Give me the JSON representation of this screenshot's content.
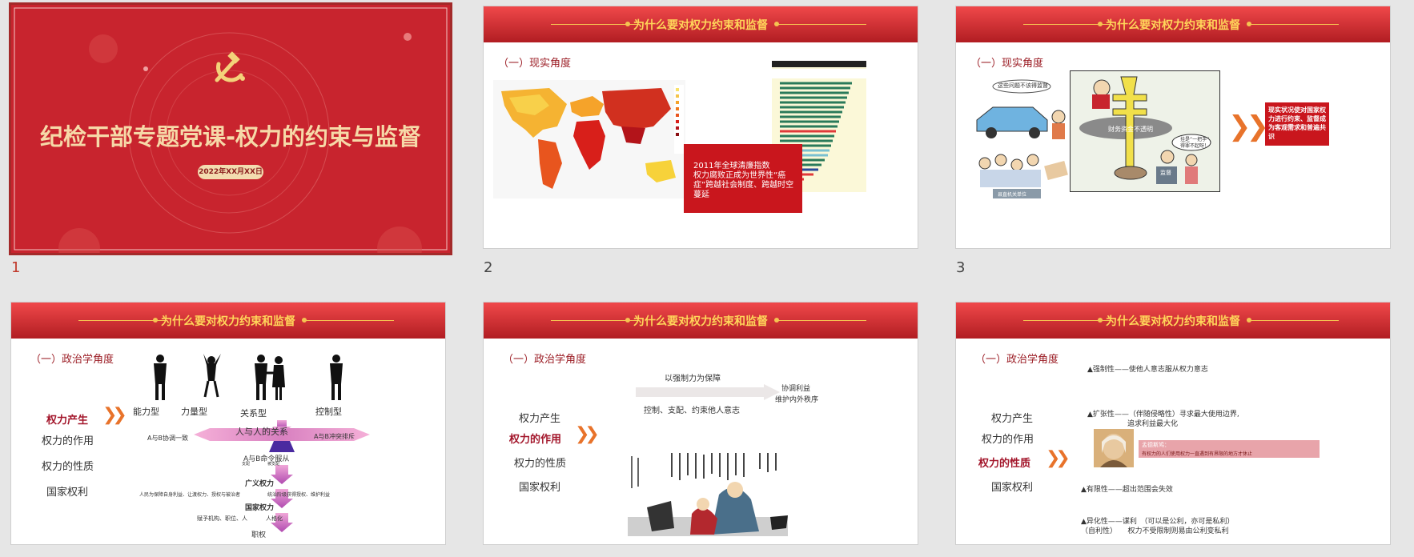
{
  "header": "为什么要对权力约束和监督",
  "slide_numbers": [
    "1",
    "2",
    "3",
    "4",
    "5",
    "6"
  ],
  "slide1": {
    "title": "纪检干部专题党课-权力的约束与监督",
    "date": "2022年XX月XX日"
  },
  "slide2": {
    "subtitle": "（一）现实角度",
    "callout": "2011年全球清廉指数\n权力腐败正成为世界性“癌症”跨越社会制度、跨越时空蔓延"
  },
  "slide3": {
    "subtitle": "（一）现实角度",
    "bubble1": "这些问题不该得监督",
    "sign1": "财务资金不透明",
    "bubble2": "挂是“一把手”\n得罪不起呀！",
    "label1": "监督",
    "sign2": "县直机关单位",
    "conclusion": "现实状况使对国家权力进行约束、监督成为客观需求和普遍共识"
  },
  "slide4": {
    "subtitle": "（一）政治学角度",
    "menu": [
      "权力产生",
      "权力的作用",
      "权力的性质",
      "国家权利"
    ],
    "types": [
      "能力型",
      "力量型",
      "关系型",
      "控制型"
    ],
    "diagram": {
      "relation": "人与人的关系",
      "left": "A与B协调一致",
      "right": "A与B冲突排斥",
      "obey": "A与B命令服从",
      "small_l": "支配",
      "small_r": "被支配",
      "broad": "广义权力",
      "broad_l": "人民为保障自身利益、让渡权力、授权与被治者",
      "broad_r": "统治阶级获得授权、维护利益",
      "narrow": "国家权力",
      "narrow_l": "赋予机构、职位、人",
      "narrow_r": "人格化",
      "duty": "职权"
    }
  },
  "slide5": {
    "subtitle": "（一）政治学角度",
    "menu": [
      "权力产生",
      "权力的作用",
      "权力的性质",
      "国家权利"
    ],
    "top": "以强制力为保障",
    "bottom": "控制、支配、约束他人意志",
    "right1": "协调利益",
    "right2": "维护内外秩序"
  },
  "slide6": {
    "subtitle": "（一）政治学角度",
    "menu": [
      "权力产生",
      "权力的作用",
      "权力的性质",
      "国家权利"
    ],
    "p1": "▲强制性——使他人意志服从权力意志",
    "p2a": "▲扩张性——（伴随侵略性）寻求最大使用边界,",
    "p2b": "追求利益最大化",
    "quote_title": "孟德斯鸠：",
    "quote": "有权力的人们使用权力一直遇到有界限的地方才休止",
    "p3": "▲有限性——超出范围会失效",
    "p4a": "▲异化性——谋利　（可以是公利，亦可是私利）",
    "p4b": "（自利性）　　权力不受限制则易由公利变私利"
  },
  "colors": {
    "red": "#c8242e",
    "gold": "#ffd65a",
    "orange": "#e8732b",
    "crimson": "#a3162b"
  }
}
